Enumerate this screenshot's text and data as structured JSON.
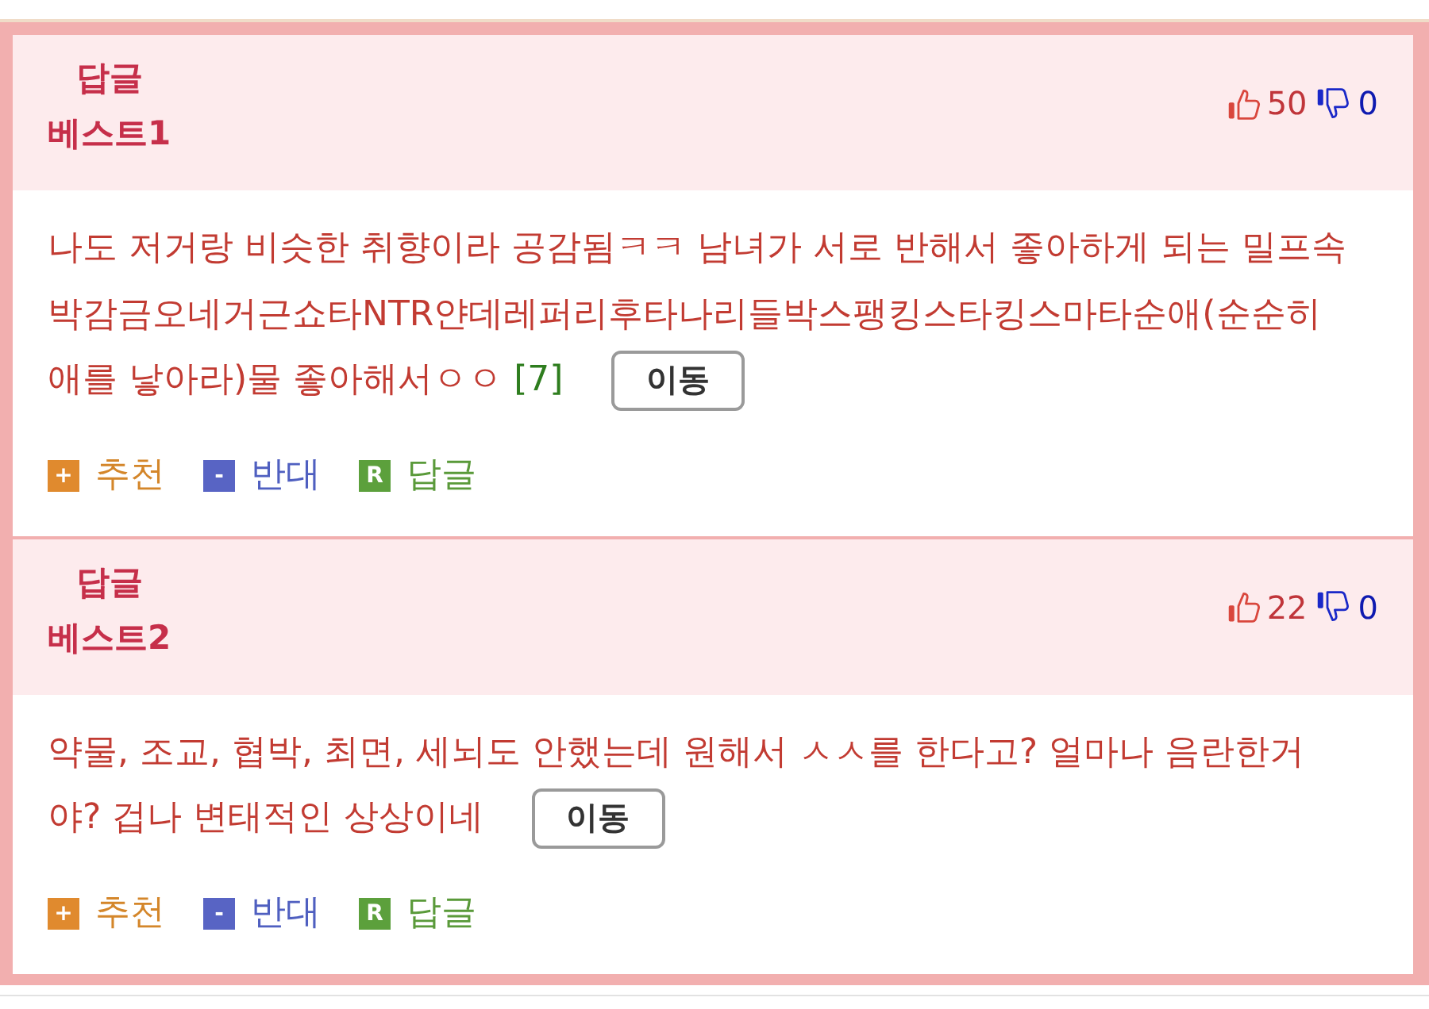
{
  "comments": [
    {
      "label": "답글",
      "rank": "베스트1",
      "likes": "50",
      "dislikes": "0",
      "text": "나도 저거랑 비슷한 취향이라 공감됨ㅋㅋ 남녀가 서로 반해서 좋아하게 되는 밀프속박감금오네거근쇼타NTR얀데레퍼리후타나리들박스팽킹스타킹스마타순애(순순히 애를 낳아라)물 좋아해서ㅇㅇ",
      "ref": "[7]",
      "move_button": "이동",
      "actions": [
        {
          "kind": "plus",
          "icon": "+",
          "label": "추천"
        },
        {
          "kind": "minus",
          "icon": "-",
          "label": "반대"
        },
        {
          "kind": "reply",
          "icon": "R",
          "label": "답글"
        }
      ]
    },
    {
      "label": "답글",
      "rank": "베스트2",
      "likes": "22",
      "dislikes": "0",
      "text": "약물, 조교, 협박, 최면, 세뇌도 안했는데 원해서 ㅅㅅ를 한다고? 얼마나 음란한거야? 겁나 변태적인 상상이네",
      "move_button": "이동",
      "actions": [
        {
          "kind": "plus",
          "icon": "+",
          "label": "추천"
        },
        {
          "kind": "minus",
          "icon": "-",
          "label": "반대"
        },
        {
          "kind": "reply",
          "icon": "R",
          "label": "답글"
        }
      ]
    }
  ]
}
